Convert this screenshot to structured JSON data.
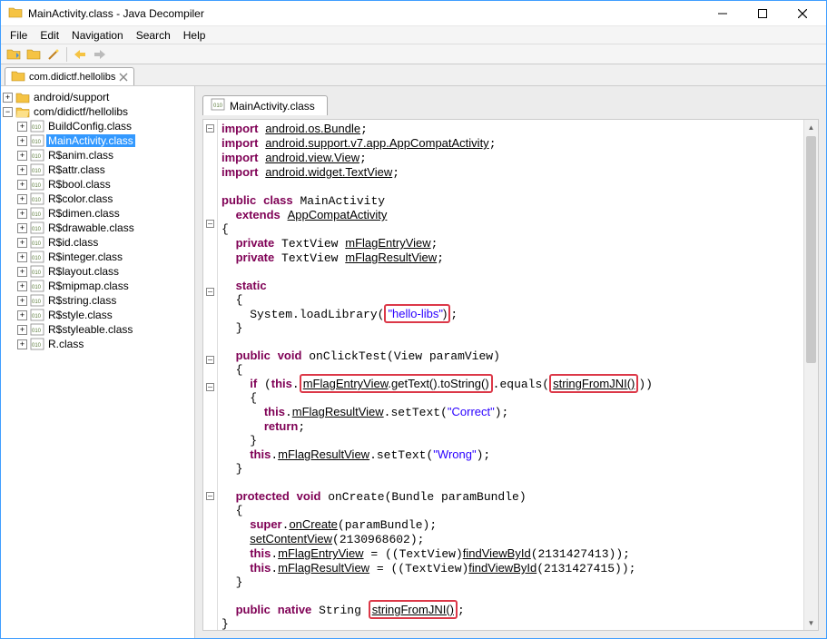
{
  "window": {
    "title": "MainActivity.class - Java Decompiler",
    "minimize": "—",
    "maximize": "□",
    "close": "✕"
  },
  "menu": {
    "file": "File",
    "edit": "Edit",
    "navigation": "Navigation",
    "search": "Search",
    "help": "Help"
  },
  "topTab": {
    "label": "com.didictf.hellolibs"
  },
  "tree": {
    "root1": "android/support",
    "root2": "com/didictf/hellolibs",
    "items": [
      "BuildConfig.class",
      "MainActivity.class",
      "R$anim.class",
      "R$attr.class",
      "R$bool.class",
      "R$color.class",
      "R$dimen.class",
      "R$drawable.class",
      "R$id.class",
      "R$integer.class",
      "R$layout.class",
      "R$mipmap.class",
      "R$string.class",
      "R$style.class",
      "R$styleable.class",
      "R.class"
    ],
    "selectedIndex": 1
  },
  "editorTab": {
    "label": "MainActivity.class"
  },
  "code": {
    "l1_import": "import",
    "l1_pkg": "android.os.Bundle",
    "l2_pkg": "android.support.v7.app.AppCompatActivity",
    "l3_pkg": "android.view.View",
    "l4_pkg": "android.widget.TextView",
    "public": "public",
    "class": "class",
    "classname": "MainActivity",
    "extends": "extends",
    "superclass": "AppCompatActivity",
    "private": "private",
    "textview": "TextView",
    "field1": "mFlagEntryView",
    "field2": "mFlagResultView",
    "static": "static",
    "sysload": "System.loadLibrary(",
    "libname": "\"hello-libs\"",
    "sysload_end": ")",
    "void": "void",
    "onclick": "onClickTest(View paramView)",
    "if": "if",
    "this": "this",
    "mflagentry": "mFlagEntryView",
    "gettext": ".getText().toString()",
    "equals": ".equals(",
    "jnicall": "stringFromJNI()",
    "settext_correct": ".setText(",
    "correct_str": "\"Correct\"",
    "return": "return",
    "mflagresult": "mFlagResultView",
    "wrong_str": "\"Wrong\"",
    "protected": "protected",
    "oncreate": "onCreate(Bundle paramBundle)",
    "super": "super",
    "oncreate_call": "onCreate",
    "parambundle": "(paramBundle);",
    "setcontent": "setContentView",
    "setcontent_arg": "(2130968602);",
    "findview": "findViewById",
    "findview_arg1": "(2131427413));",
    "findview_arg2": "(2131427415));",
    "native": "native",
    "string_type": "String",
    "jni_method": "stringFromJNI()"
  },
  "gutter": {
    "minus": "⊖",
    "circle": "○"
  }
}
